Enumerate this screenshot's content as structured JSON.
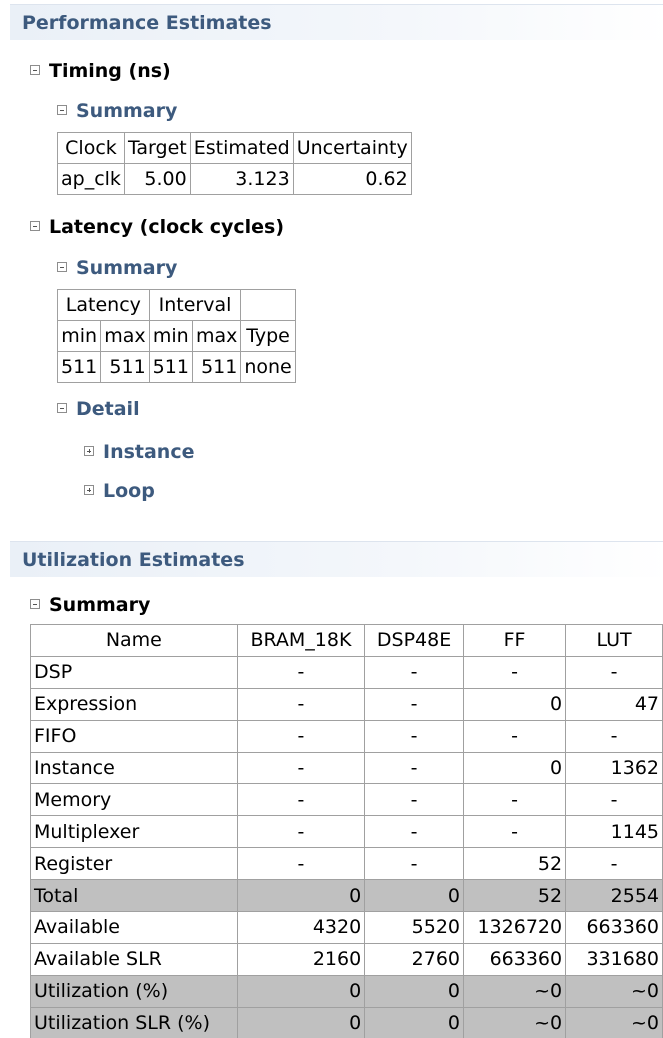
{
  "performance": {
    "header": "Performance Estimates",
    "timing": {
      "title": "Timing (ns)",
      "summary_title": "Summary",
      "headers": [
        "Clock",
        "Target",
        "Estimated",
        "Uncertainty"
      ],
      "row": [
        "ap_clk",
        "5.00",
        "3.123",
        "0.62"
      ]
    },
    "latency": {
      "title": "Latency (clock cycles)",
      "summary_title": "Summary",
      "group_headers": [
        "Latency",
        "Interval",
        ""
      ],
      "sub_headers": [
        "min",
        "max",
        "min",
        "max",
        "Type"
      ],
      "row": [
        "511",
        "511",
        "511",
        "511",
        "none"
      ],
      "detail_title": "Detail",
      "instance_label": "Instance",
      "loop_label": "Loop"
    }
  },
  "utilization": {
    "header": "Utilization Estimates",
    "summary_title": "Summary",
    "columns": [
      "Name",
      "BRAM_18K",
      "DSP48E",
      "FF",
      "LUT"
    ],
    "rows": [
      [
        "DSP",
        "-",
        "-",
        "-",
        "-"
      ],
      [
        "Expression",
        "-",
        "-",
        "0",
        "47"
      ],
      [
        "FIFO",
        "-",
        "-",
        "-",
        "-"
      ],
      [
        "Instance",
        "-",
        "-",
        "0",
        "1362"
      ],
      [
        "Memory",
        "-",
        "-",
        "-",
        "-"
      ],
      [
        "Multiplexer",
        "-",
        "-",
        "-",
        "1145"
      ],
      [
        "Register",
        "-",
        "-",
        "52",
        "-"
      ],
      [
        "Total",
        "0",
        "0",
        "52",
        "2554"
      ],
      [
        "Available",
        "4320",
        "5520",
        "1326720",
        "663360"
      ],
      [
        "Available SLR",
        "2160",
        "2760",
        "663360",
        "331680"
      ],
      [
        "Utilization (%)",
        "0",
        "0",
        "~0",
        "~0"
      ],
      [
        "Utilization SLR (%)",
        "0",
        "0",
        "~0",
        "~0"
      ]
    ]
  }
}
